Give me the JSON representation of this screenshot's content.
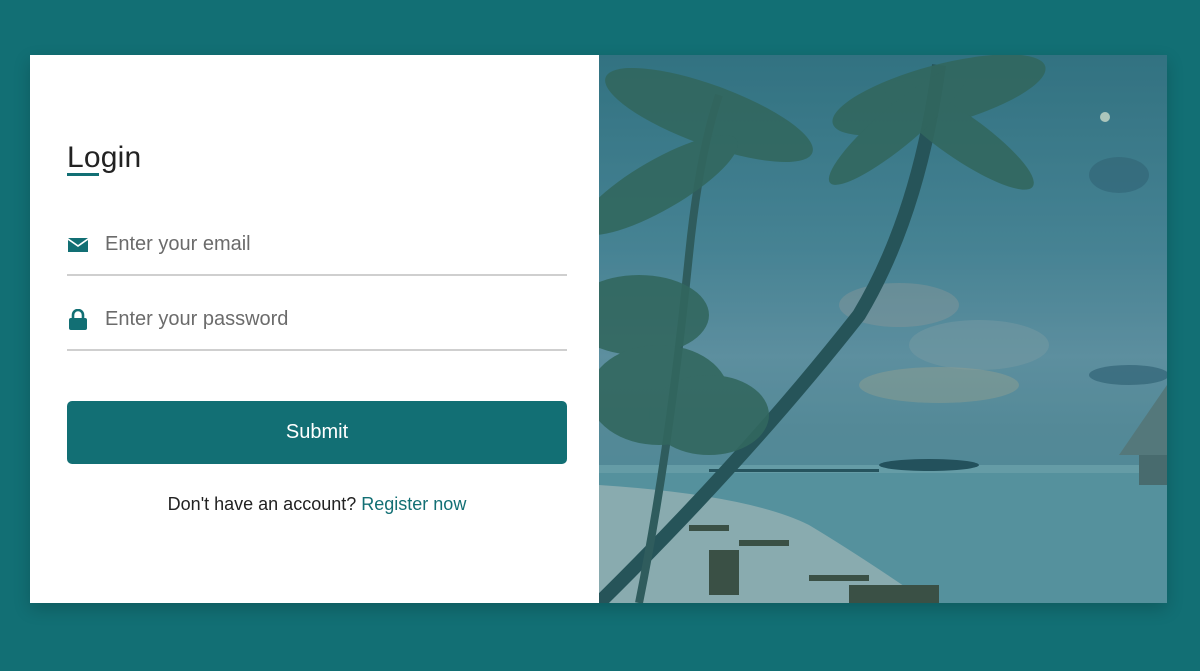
{
  "login": {
    "title": "Login",
    "email_placeholder": "Enter your email",
    "password_placeholder": "Enter your password",
    "submit_label": "Submit",
    "register_prompt": "Don't have an account?",
    "register_link": "Register now"
  },
  "icons": {
    "email": "envelope-icon",
    "password": "lock-icon"
  },
  "colors": {
    "accent": "#126f74",
    "background": "#126f74",
    "card": "#ffffff"
  }
}
